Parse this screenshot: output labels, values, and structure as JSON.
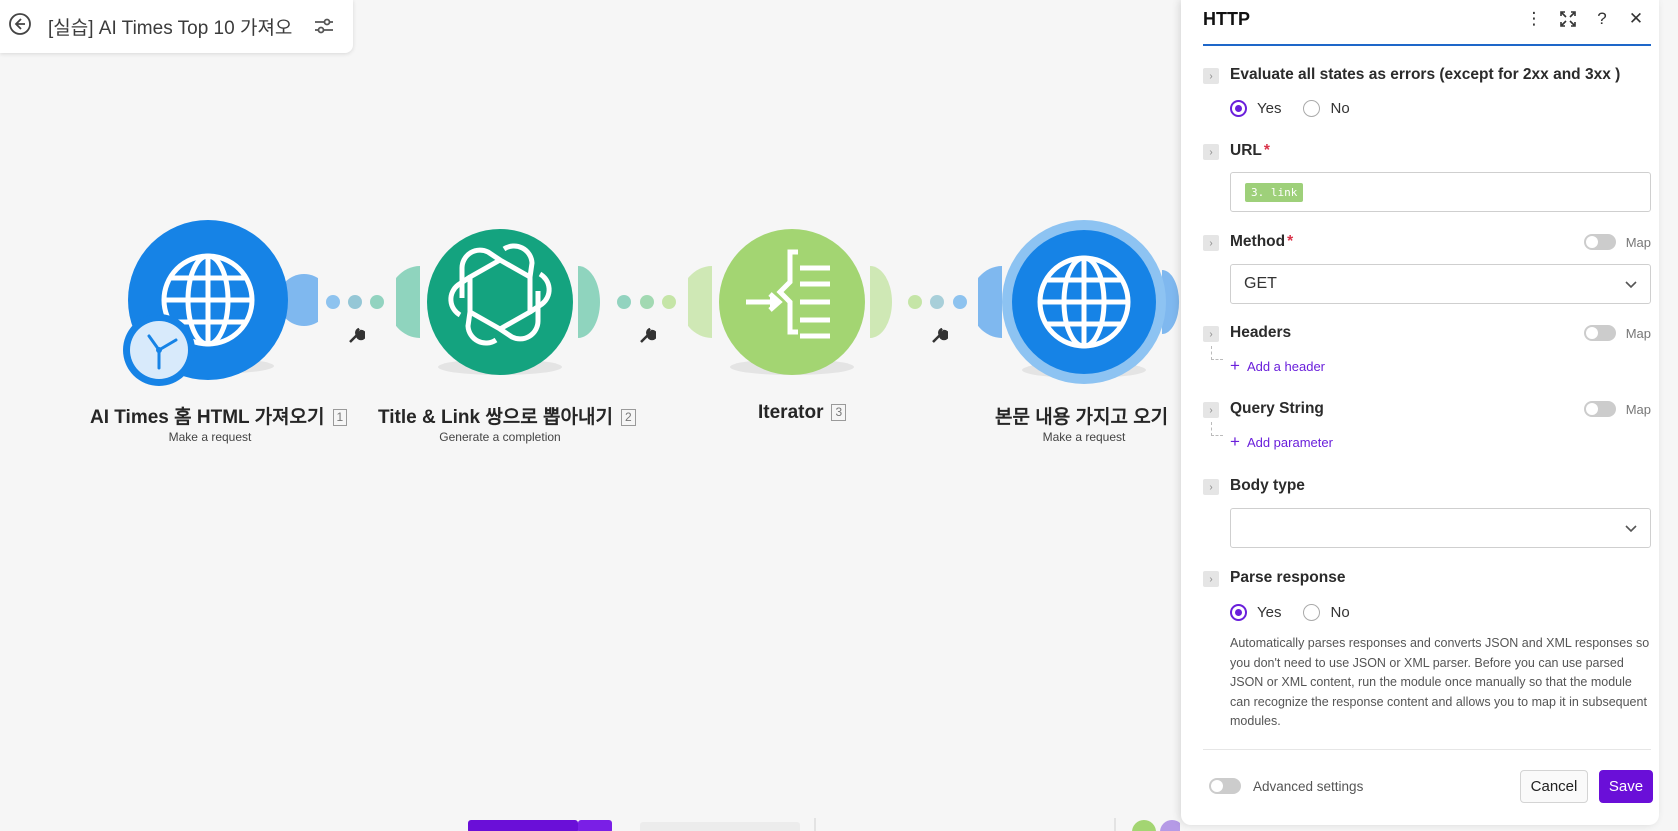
{
  "scenario": {
    "title": "[실습] AI Times Top 10 가져오"
  },
  "modules": [
    {
      "title": "AI Times 홈 HTML 가져오기",
      "num": "1",
      "subtitle": "Make a request"
    },
    {
      "title": "Title & Link 쌍으로 뽑아내기",
      "num": "2",
      "subtitle": "Generate a completion"
    },
    {
      "title": "Iterator",
      "num": "3",
      "subtitle": ""
    },
    {
      "title": "본문 내용 가지고 오기",
      "num": "",
      "subtitle": "Make a request"
    }
  ],
  "colors": {
    "http_blue": "#1683e6",
    "openai_green": "#14a37f",
    "iterator_green": "#a3d572",
    "accent_purple": "#6a0fd8",
    "header_underline": "#1e67c9"
  },
  "panel": {
    "title": "HTTP",
    "evaluate": {
      "label": "Evaluate all states as errors (except for 2xx and 3xx )",
      "yes": "Yes",
      "no": "No",
      "selected": "Yes"
    },
    "url": {
      "label": "URL",
      "required": "*",
      "value": "3. link"
    },
    "method": {
      "label": "Method",
      "required": "*",
      "map_label": "Map",
      "value": "GET"
    },
    "headers": {
      "label": "Headers",
      "map_label": "Map",
      "add_label": "Add a header"
    },
    "query": {
      "label": "Query String",
      "map_label": "Map",
      "add_label": "Add parameter"
    },
    "body_type": {
      "label": "Body type",
      "value": ""
    },
    "parse": {
      "label": "Parse response",
      "yes": "Yes",
      "no": "No",
      "selected": "Yes",
      "help": "Automatically parses responses and converts JSON and XML responses so you don't need to use JSON or XML parser. Before you can use parsed JSON or XML content, run the module once manually so that the module can recognize the response content and allows you to map it in subsequent modules."
    },
    "advanced_label": "Advanced settings",
    "cancel_label": "Cancel",
    "save_label": "Save"
  }
}
